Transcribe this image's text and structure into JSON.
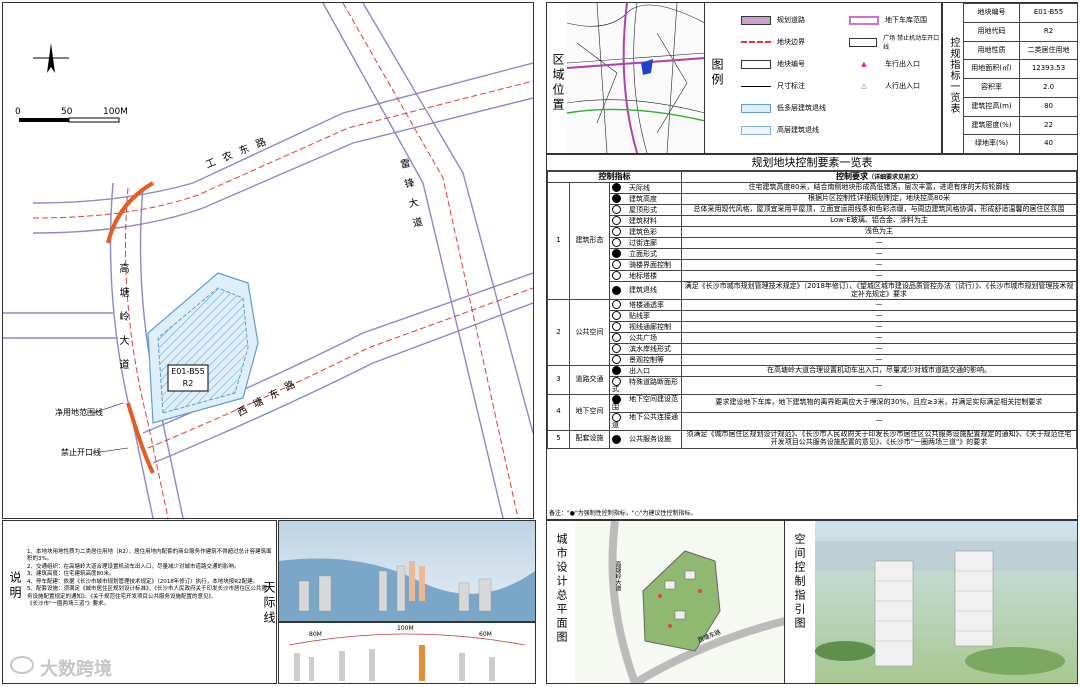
{
  "map": {
    "block_code": "E01-B55",
    "block_use": "R2",
    "roads": {
      "r1": "工农东路",
      "r2": "雷锋大道",
      "r3": "高塘岭大道",
      "r4": "西塘东路"
    },
    "scale": {
      "s0": "0",
      "s1": "50",
      "s2": "100M"
    },
    "callouts": {
      "net_line": "净用地范围线",
      "no_open": "禁止开口线"
    }
  },
  "notes": {
    "title": "说明",
    "lines": [
      "1、本地块用地性质为二类居住用地（R2），居住用地内配套的商业服务作建筑不得超过总计容建筑面积的3%。",
      "2、交通组织：在高塘岭大道合理设置机动车出入口，尽量减少对城市道路交通的影响。",
      "3、建筑高度：住宅建筑高度80米。",
      "4、停车配建：依据《长沙市城市规划管理技术规定》（2018年修订）执行，本地块按R2配建。",
      "5、配套设施：须满足《城市居住区规划设计标准》、《长沙市人民政府关于印发长沙市居住区公共服务设施配置规定的通知》、《关于规范住宅开发项目公共服务设施配置的意见》、",
      "《长沙市\"一圈两场三道\"》要求。"
    ]
  },
  "skyline": {
    "title": "天际线",
    "h1": "80M",
    "h2": "100M",
    "h3": "60M"
  },
  "location": {
    "title": "区域位置"
  },
  "legend": {
    "title": "图例",
    "items": [
      "规划道路",
      "地块边界",
      "地块编号",
      "尺寸标注",
      "低多层建筑退线",
      "高层建筑退线",
      "地下车库范围",
      "广场 禁止机动车开口线",
      "车行出入口",
      "人行出入口"
    ],
    "colors": {
      "road": "#c8a2c8",
      "boundary": "#e23a3a",
      "garage": "#d070d0",
      "vehicle": "#e020a0",
      "ped": "#40a040"
    }
  },
  "indicators": {
    "title": "控规指标一览表",
    "rows": [
      {
        "k": "地块编号",
        "v": "E01-B55"
      },
      {
        "k": "用地代码",
        "v": "R2"
      },
      {
        "k": "用地性质",
        "v": "二类居住用地"
      },
      {
        "k": "用地面积(㎡)",
        "v": "12393.53"
      },
      {
        "k": "容积率",
        "v": "2.0"
      },
      {
        "k": "建筑控高(m)",
        "v": "80"
      },
      {
        "k": "建筑密度(%)",
        "v": "22"
      },
      {
        "k": "绿地率(%)",
        "v": "40"
      }
    ]
  },
  "control": {
    "title": "规划地块控制要素一览表",
    "h_control": "控制指标",
    "h_req": "控制要求",
    "h_req_note": "（详细要求见前文）",
    "groups": [
      {
        "no": "1",
        "name": "建筑形态",
        "items": [
          {
            "f": true,
            "n": "天际线",
            "r": "住宅建筑高度80米，结合南侧地块形成高低错落，层次丰富，进退有序的天际轮廓线"
          },
          {
            "f": true,
            "n": "建筑高度",
            "r": "根据片区控制性详细规划制定，地块控高80米"
          },
          {
            "f": false,
            "n": "屋顶形式",
            "r": "总体采用现代风格，屋顶宜采用平屋顶，立面宜运用线条和色彩点缀，与周边建筑风格协调，形成舒适温馨的居住区氛围"
          },
          {
            "f": false,
            "n": "建筑材料",
            "r": "Low-E玻璃、铝合金、涂料为主"
          },
          {
            "f": false,
            "n": "建筑色彩",
            "r": "浅色为主"
          },
          {
            "f": false,
            "n": "过街连廊",
            "r": "—"
          },
          {
            "f": true,
            "n": "立面形式",
            "r": "—"
          },
          {
            "f": false,
            "n": "骑楼界面控制",
            "r": "—"
          },
          {
            "f": false,
            "n": "地标塔楼",
            "r": "—"
          },
          {
            "f": true,
            "n": "建筑退线",
            "r": "满足《长沙市城市规划管理技术规定》（2018年修订）、《望城区城市建设品质管控办法（试行）》、《长沙市城市规划管理技术规定补充规定》要求"
          }
        ]
      },
      {
        "no": "2",
        "name": "公共空间",
        "items": [
          {
            "f": false,
            "n": "塔楼通透率",
            "r": "—"
          },
          {
            "f": false,
            "n": "贴线率",
            "r": "—"
          },
          {
            "f": false,
            "n": "视线通廊控制",
            "r": "—"
          },
          {
            "f": false,
            "n": "公共广场",
            "r": "—"
          },
          {
            "f": false,
            "n": "滨水岸线形式",
            "r": "—"
          },
          {
            "f": false,
            "n": "景观控制等",
            "r": "—"
          }
        ]
      },
      {
        "no": "3",
        "name": "道路交通",
        "items": [
          {
            "f": true,
            "n": "出入口",
            "r": "在高塘岭大道合理设置机动车出入口，尽量减少对城市道路交通的影响。"
          },
          {
            "f": false,
            "n": "特殊道路断面形式",
            "r": "—"
          }
        ]
      },
      {
        "no": "4",
        "name": "地下空间",
        "items": [
          {
            "f": true,
            "n": "地下空间建设范围",
            "r": "要求建设地下车库，地下建筑物的离界距离应大于埋深的30%，且应≥3米，并满足实际满足相关控制要求"
          },
          {
            "f": false,
            "n": "地下公共连接通道",
            "r": "—"
          }
        ]
      },
      {
        "no": "5",
        "name": "配套设施",
        "items": [
          {
            "f": true,
            "n": "公共服务设施",
            "r": "须满足《城市居住区规划设计规范》、《长沙市人民政府关于印发长沙市居住区公共服务设施配置规定的通知》、《关于规范住宅开发项目公共服务设施配置的意见》、《长沙市\"一圈两场三道\"》的要求"
          }
        ]
      }
    ],
    "footnote": "备注：\"●\"为强制性控制指标，\"○\"为建议性控制指标。"
  },
  "plan": {
    "title": "城市设计总平面图",
    "road_a": "高塘岭大道",
    "road_b": "西塘东路"
  },
  "guide": {
    "title": "空间控制指引图"
  },
  "watermark": "大数跨境"
}
